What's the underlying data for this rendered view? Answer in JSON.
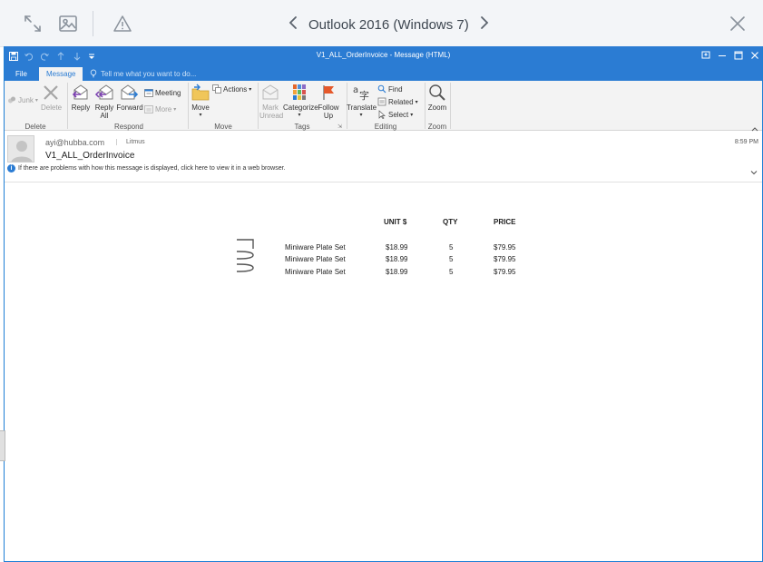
{
  "preview_bar": {
    "title": "Outlook 2016 (Windows 7)",
    "icons": [
      "expand-icon",
      "image-icon",
      "warning-icon",
      "prev-chevron-icon",
      "next-chevron-icon",
      "close-icon"
    ]
  },
  "window": {
    "title": "V1_ALL_OrderInvoice - Message (HTML)",
    "menu": {
      "file": "File",
      "message": "Message",
      "tell_me": "Tell me what you want to do..."
    }
  },
  "ribbon": {
    "delete_group": {
      "label": "Delete",
      "junk": "Junk",
      "delete": "Delete"
    },
    "respond_group": {
      "label": "Respond",
      "reply": "Reply",
      "reply_all_1": "Reply",
      "reply_all_2": "All",
      "forward": "Forward",
      "meeting": "Meeting",
      "more": "More"
    },
    "move_group": {
      "label": "Move",
      "move": "Move",
      "actions": "Actions"
    },
    "tags_group": {
      "label": "Tags",
      "mark_unread_1": "Mark",
      "mark_unread_2": "Unread",
      "categorize": "Categorize",
      "follow_up_1": "Follow",
      "follow_up_2": "Up"
    },
    "editing_group": {
      "label": "Editing",
      "translate": "Translate",
      "find": "Find",
      "related": "Related",
      "select": "Select"
    },
    "zoom_group": {
      "label": "Zoom",
      "zoom": "Zoom"
    }
  },
  "message": {
    "from": "ayi@hubba.com",
    "to": "Litmus",
    "time": "8:59 PM",
    "subject": "V1_ALL_OrderInvoice",
    "info": "If there are problems with how this message is displayed, click here to view it in a web browser."
  },
  "invoice": {
    "headers": {
      "unit": "UNIT $",
      "qty": "QTY",
      "price": "PRICE"
    },
    "rows": [
      {
        "item": "Miniware Plate Set",
        "unit": "$18.99",
        "qty": "5",
        "price": "$79.95"
      },
      {
        "item": "Miniware Plate Set",
        "unit": "$18.99",
        "qty": "5",
        "price": "$79.95"
      },
      {
        "item": "Miniware Plate Set",
        "unit": "$18.99",
        "qty": "5",
        "price": "$79.95"
      }
    ]
  }
}
